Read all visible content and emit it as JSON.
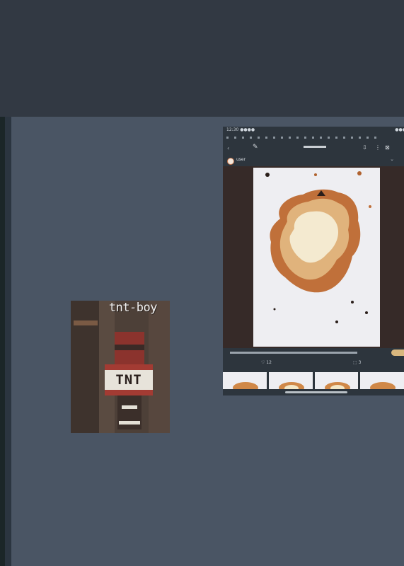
{
  "sticker": {
    "label": "tnt-boy",
    "block_text": "TNT"
  },
  "preview": {
    "header_left": "12:30 ●●●●",
    "header_right": "●●●",
    "nav": {
      "back_icon": "‹",
      "edit_icon": "✎",
      "icons": [
        "⇩",
        "⋮",
        "⊠"
      ]
    },
    "user": {
      "name": "user",
      "more_icon": "⌄"
    },
    "stats": [
      "♡ 12",
      "⬚ 3"
    ]
  },
  "colors": {
    "canvas": "#4a5564",
    "topbar": "#323943",
    "accent": "#d08848"
  }
}
